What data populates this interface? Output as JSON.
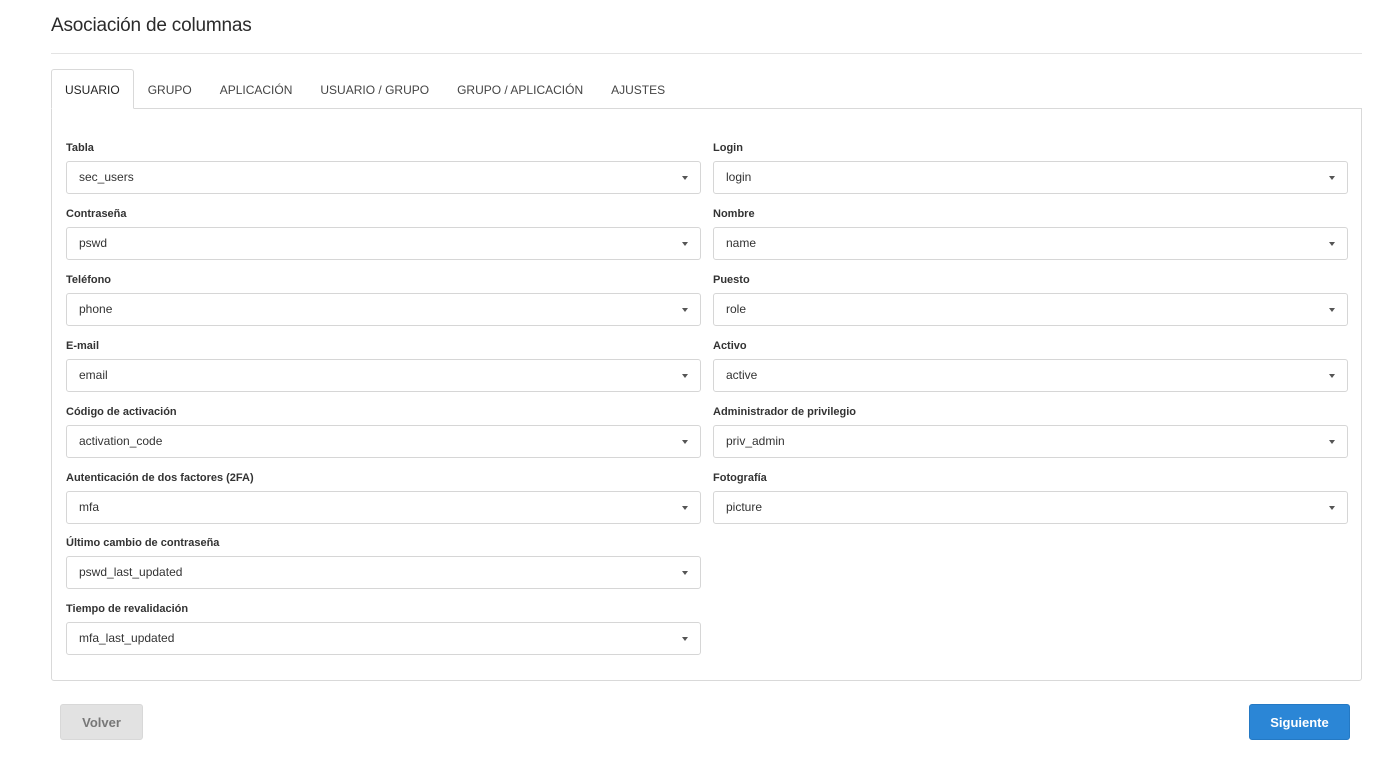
{
  "page": {
    "title": "Asociación de columnas"
  },
  "tabs": [
    {
      "label": "USUARIO",
      "active": true
    },
    {
      "label": "GRUPO",
      "active": false
    },
    {
      "label": "APLICACIÓN",
      "active": false
    },
    {
      "label": "USUARIO / GRUPO",
      "active": false
    },
    {
      "label": "GRUPO / APLICACIÓN",
      "active": false
    },
    {
      "label": "AJUSTES",
      "active": false
    }
  ],
  "fields": {
    "tabla": {
      "label": "Tabla",
      "value": "sec_users"
    },
    "login": {
      "label": "Login",
      "value": "login"
    },
    "contrasena": {
      "label": "Contraseña",
      "value": "pswd"
    },
    "nombre": {
      "label": "Nombre",
      "value": "name"
    },
    "telefono": {
      "label": "Teléfono",
      "value": "phone"
    },
    "puesto": {
      "label": "Puesto",
      "value": "role"
    },
    "email": {
      "label": "E-mail",
      "value": "email"
    },
    "activo": {
      "label": "Activo",
      "value": "active"
    },
    "codigo_activacion": {
      "label": "Código de activación",
      "value": "activation_code"
    },
    "admin_privilegio": {
      "label": "Administrador de privilegio",
      "value": "priv_admin"
    },
    "mfa": {
      "label": "Autenticación de dos factores (2FA)",
      "value": "mfa"
    },
    "fotografia": {
      "label": "Fotografía",
      "value": "picture"
    },
    "ultimo_cambio": {
      "label": "Último cambio de contraseña",
      "value": "pswd_last_updated"
    },
    "revalidacion": {
      "label": "Tiempo de revalidación",
      "value": "mfa_last_updated"
    }
  },
  "buttons": {
    "back": "Volver",
    "next": "Siguiente"
  },
  "icons": {
    "dropdown": "caret-down-icon"
  },
  "colors": {
    "primary": "#2b86d6",
    "secondary": "#e2e2e2",
    "border": "#d9d9d9"
  }
}
